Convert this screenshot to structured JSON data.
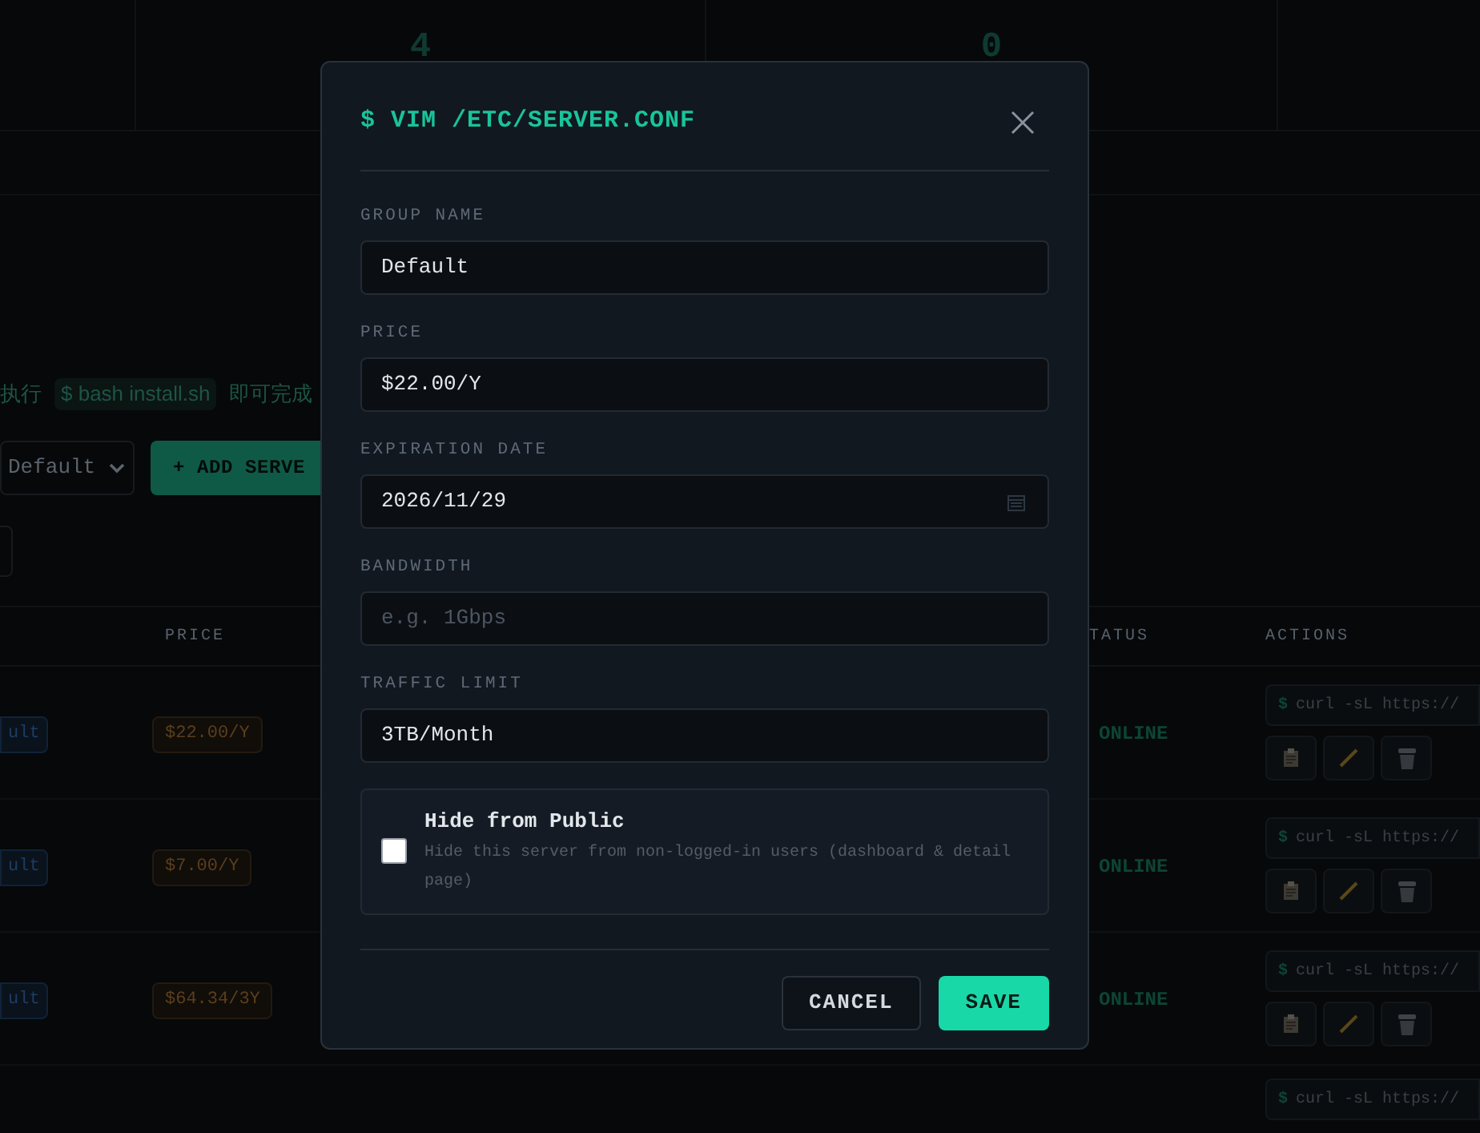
{
  "stats": [
    {
      "value": "4"
    },
    {
      "value": "0"
    }
  ],
  "notice": {
    "before": "执行",
    "command": "$ bash install.sh",
    "after": "即可完成"
  },
  "toolbar": {
    "group_select": "Default",
    "add_button": "+ ADD SERVE"
  },
  "table": {
    "columns": [
      "PRICE",
      "TATUS",
      "ACTIONS"
    ],
    "rows": [
      {
        "group": "ult",
        "price": "$22.00/Y",
        "status": "ONLINE",
        "prompt": "$",
        "command": "curl -sL https://"
      },
      {
        "group": "ult",
        "price": "$7.00/Y",
        "status": "ONLINE",
        "prompt": "$",
        "command": "curl -sL https://"
      },
      {
        "group": "ult",
        "price": "$64.34/3Y",
        "status": "ONLINE",
        "prompt": "$",
        "command": "curl -sL https://"
      },
      {
        "prompt": "$",
        "command": "curl -sL https://"
      }
    ]
  },
  "dialog": {
    "title": "$ VIM /ETC/SERVER.CONF",
    "fields": [
      {
        "kind": "text",
        "label": "GROUP NAME",
        "value": "Default"
      },
      {
        "kind": "text",
        "label": "PRICE",
        "value": "$22.00/Y"
      },
      {
        "kind": "date",
        "label": "EXPIRATION DATE",
        "value": "2026/11/29"
      },
      {
        "kind": "text",
        "label": "BANDWIDTH",
        "placeholder": "e.g. 1Gbps"
      },
      {
        "kind": "text",
        "label": "TRAFFIC LIMIT",
        "value": "3TB/Month"
      }
    ],
    "option": {
      "label": "Hide from Public",
      "description": "Hide this server from non-logged-in users (dashboard & detail page)",
      "checked": false
    },
    "buttons": [
      {
        "kind": "secondary",
        "label": "CANCEL"
      },
      {
        "kind": "primary",
        "label": "SAVE"
      }
    ]
  }
}
